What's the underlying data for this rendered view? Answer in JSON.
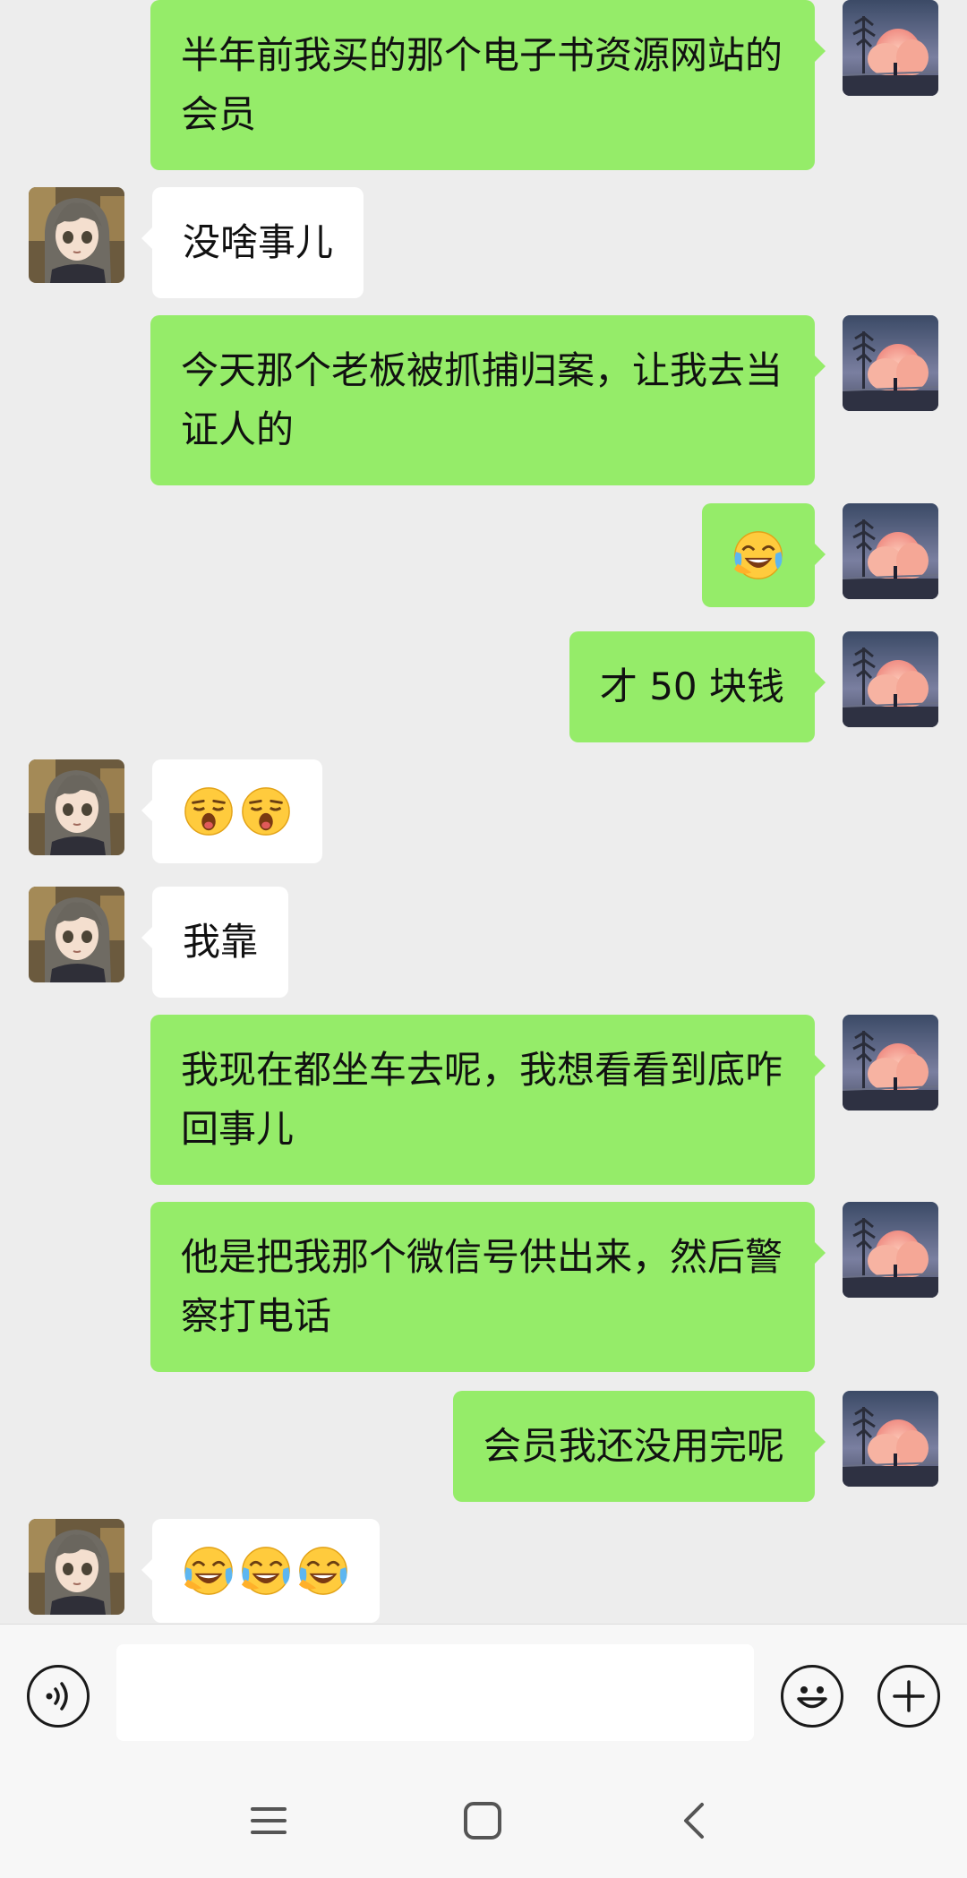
{
  "messages": [
    {
      "side": "out",
      "text": "半年前我买的那个电子书资源网站的会员"
    },
    {
      "side": "in",
      "text": "没啥事儿"
    },
    {
      "side": "out",
      "text": "今天那个老板被抓捕归案，让我去当证人的"
    },
    {
      "side": "out",
      "emoji": [
        "face-with-tears-of-joy-icon"
      ]
    },
    {
      "side": "out",
      "text": "才 50 块钱"
    },
    {
      "side": "in",
      "emoji": [
        "yawning-face-icon",
        "yawning-face-icon"
      ]
    },
    {
      "side": "in",
      "text": "我靠"
    },
    {
      "side": "out",
      "text": "我现在都坐车去呢，我想看看到底咋回事儿"
    },
    {
      "side": "out",
      "text": "他是把我那个微信号供出来，然后警察打电话"
    },
    {
      "side": "out",
      "text": "会员我还没用完呢"
    },
    {
      "side": "in",
      "emoji": [
        "face-with-tears-of-joy-icon",
        "face-with-tears-of-joy-icon",
        "face-with-tears-of-joy-icon"
      ]
    }
  ],
  "input": {
    "placeholder": "",
    "value": ""
  },
  "colors": {
    "outgoing_bubble": "#95ec69",
    "incoming_bubble": "#ffffff",
    "background": "#ededed"
  },
  "icons": {
    "voice": "voice-icon",
    "emoji": "emoji-icon",
    "plus": "plus-icon",
    "nav_menu": "menu-icon",
    "nav_home": "home-icon",
    "nav_back": "back-icon"
  }
}
